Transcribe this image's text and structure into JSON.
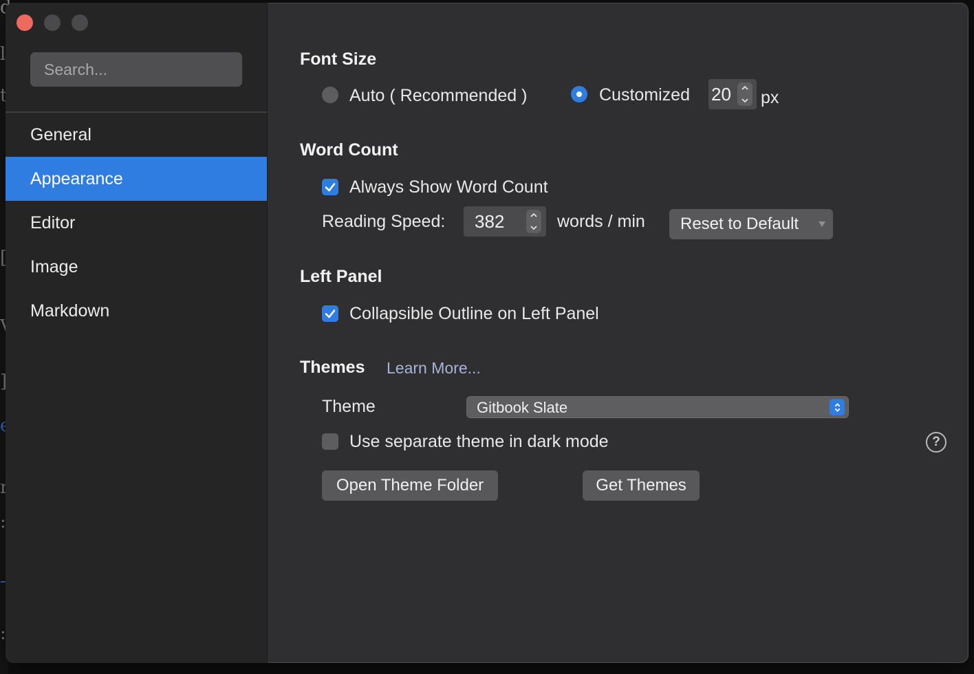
{
  "background_text": {
    "glyphs": [
      "d",
      "l",
      "t",
      "[",
      "V",
      "]",
      "e",
      "r",
      ":",
      "-",
      ":"
    ]
  },
  "sidebar": {
    "search_placeholder": "Search...",
    "items": [
      {
        "label": "General"
      },
      {
        "label": "Appearance",
        "active": true
      },
      {
        "label": "Editor"
      },
      {
        "label": "Image"
      },
      {
        "label": "Markdown"
      }
    ]
  },
  "font_size": {
    "title": "Font Size",
    "auto_label": "Auto ( Recommended )",
    "custom_label": "Customized",
    "value": "20",
    "unit": "px"
  },
  "word_count": {
    "title": "Word Count",
    "always_show_label": "Always Show Word Count",
    "reading_speed_label": "Reading Speed:",
    "reading_speed_value": "382",
    "unit": "words / min",
    "reset_label": "Reset to Default"
  },
  "left_panel": {
    "title": "Left Panel",
    "collapsible_label": "Collapsible Outline on Left Panel"
  },
  "themes": {
    "title": "Themes",
    "learn_more": "Learn More...",
    "theme_label": "Theme",
    "theme_value": "Gitbook Slate",
    "dark_mode_label": "Use separate theme in dark mode",
    "open_folder_label": "Open Theme Folder",
    "get_themes_label": "Get Themes",
    "help_symbol": "?"
  },
  "colors": {
    "accent": "#2f7de1",
    "close": "#ed6a5e",
    "window_bg": "#2f2f31",
    "sidebar_bg": "#252526"
  }
}
